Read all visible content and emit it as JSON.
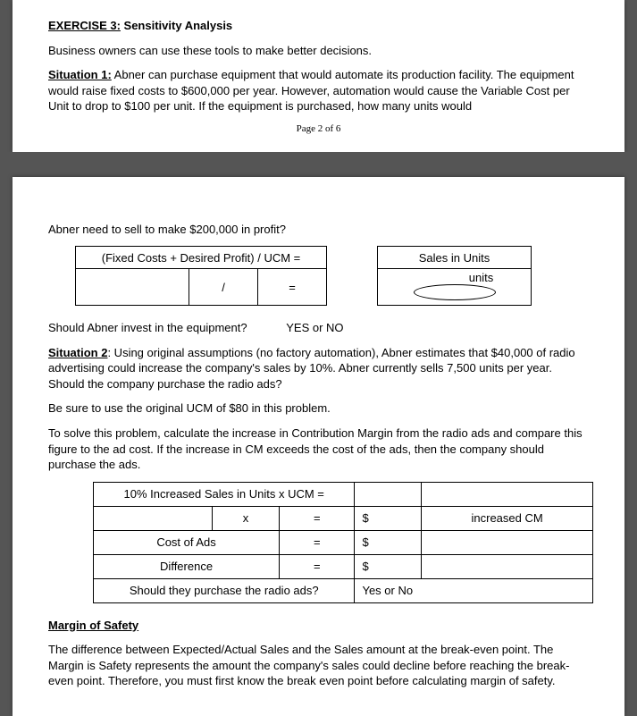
{
  "top": {
    "exercise_label": "EXERCISE 3:",
    "exercise_title": " Sensitivity Analysis",
    "intro": "Business owners can use these tools to make better decisions.",
    "sit1_label": "Situation 1:",
    "sit1_text": "  Abner can purchase equipment that would automate its production facility.  The equipment would raise fixed costs to $600,000 per year. However, automation would cause the Variable Cost per Unit to drop to $100 per unit.  If the equipment is purchased, how many units would",
    "page_num": "Page 2 of 6"
  },
  "bottom": {
    "cont": "Abner need to sell to make $200,000 in profit?",
    "table1": {
      "h1": "(Fixed Costs + Desired Profit) /  UCM   =",
      "h2": "Sales in Units",
      "r_div": "/",
      "r_eq": "=",
      "r_units": "units"
    },
    "invest_q": "Should Abner invest in the equipment?",
    "yesno": "YES  or  NO",
    "sit2_label": "Situation 2",
    "sit2_text": ": Using original assumptions (no factory automation), Abner estimates that $40,000 of radio advertising could increase the company's sales by 10%. Abner currently sells 7,500 units per year.  Should the company purchase the radio ads?",
    "ucm_note": "Be sure to use the original UCM of $80 in this problem.",
    "solve_note": "To solve this problem, calculate the increase in Contribution Margin from the radio ads and compare this figure to the ad cost.  If the increase in CM exceeds the cost of the ads, then the company should purchase the ads.",
    "table2": {
      "hdr": "10% Increased Sales in Units  x  UCM    =",
      "x": "x",
      "eq": "=",
      "dollar": "$",
      "inc_cm": "increased CM",
      "cost_ads": "Cost of Ads",
      "diff": "Difference",
      "should": "Should they purchase the radio ads?",
      "yesno": "Yes  or  No"
    },
    "mos_title": "Margin of Safety",
    "mos_text": "The difference between Expected/Actual Sales and the Sales amount at the break-even point.  The Margin is Safety represents the amount the company's sales could decline before reaching the break-even point.  Therefore, you must first know the break even point before calculating margin of safety."
  }
}
